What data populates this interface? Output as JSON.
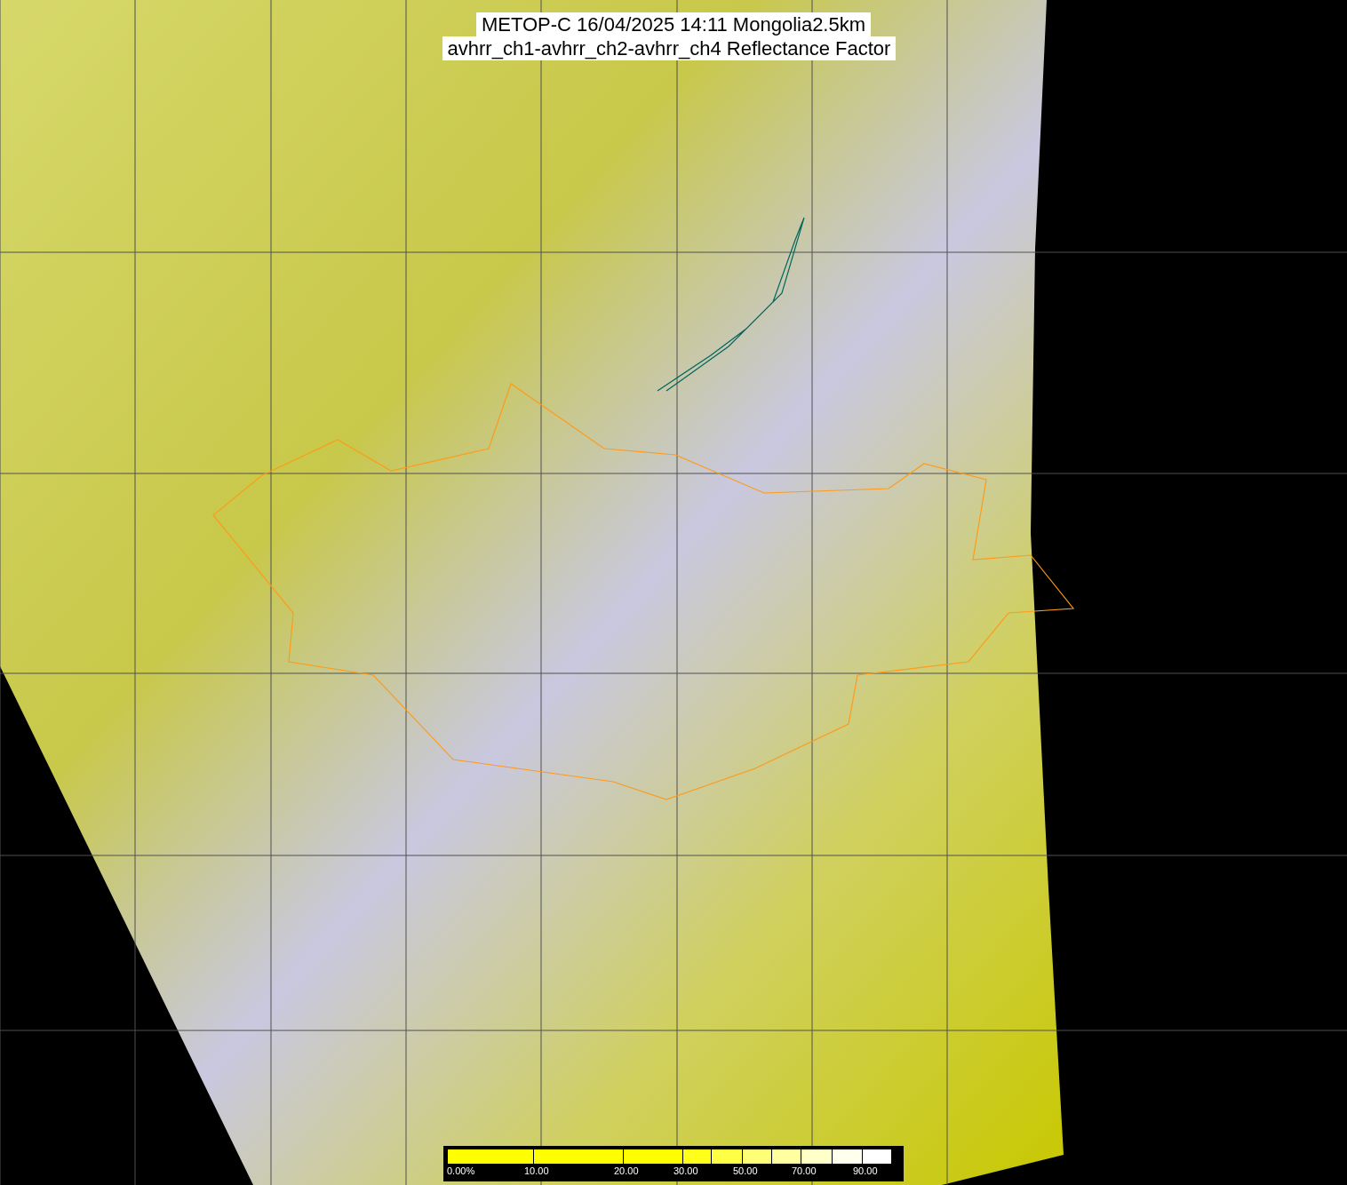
{
  "title": {
    "lines": [
      "METOP-C 16/04/2025 14:11 Mongolia2.5km",
      "avhrr_ch1-avhrr_ch2-avhrr_ch4 Reflectance Factor"
    ]
  },
  "legend": {
    "segments": [
      {
        "color": "#ffff00",
        "label": "0.00%"
      },
      {
        "color": "#ffff00",
        "label": "10.00"
      },
      {
        "color": "#ffff00",
        "label": "20.00"
      },
      {
        "color": "#ffff1a",
        "label": "30.00"
      },
      {
        "color": "#ffff44"
      },
      {
        "color": "#ffff77",
        "label": "50.00"
      },
      {
        "color": "#ffffa0"
      },
      {
        "color": "#ffffc8",
        "label": "70.00"
      },
      {
        "color": "#ffffee"
      },
      {
        "color": "#ffffff",
        "label": "90.00"
      }
    ]
  }
}
